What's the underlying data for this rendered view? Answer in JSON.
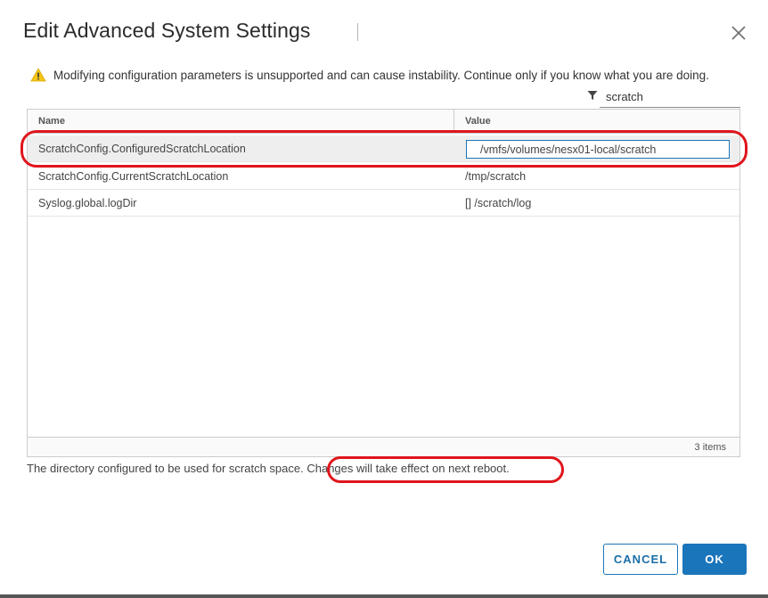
{
  "dialog": {
    "title": "Edit Advanced System Settings",
    "close_icon": "close-icon"
  },
  "warning": {
    "icon": "warning-icon",
    "text": "Modifying configuration parameters is unsupported and can cause instability. Continue only if you know what you are doing."
  },
  "filter": {
    "icon": "filter-icon",
    "value": "scratch"
  },
  "grid": {
    "columns": [
      "Name",
      "Value"
    ],
    "rows": [
      {
        "name": "ScratchConfig.ConfiguredScratchLocation",
        "value": "/vmfs/volumes/nesx01-local/scratch",
        "editing": true
      },
      {
        "name": "ScratchConfig.CurrentScratchLocation",
        "value": "/tmp/scratch"
      },
      {
        "name": "Syslog.global.logDir",
        "value": "[] /scratch/log"
      }
    ],
    "footer": "3 items"
  },
  "description": {
    "text": "The directory configured to be used for scratch space.",
    "note": "Changes will take effect on next reboot."
  },
  "buttons": {
    "cancel": "CANCEL",
    "ok": "OK"
  },
  "colors": {
    "accent": "#1b75bb",
    "highlight": "#e0151c",
    "warning": "#f5c518"
  }
}
